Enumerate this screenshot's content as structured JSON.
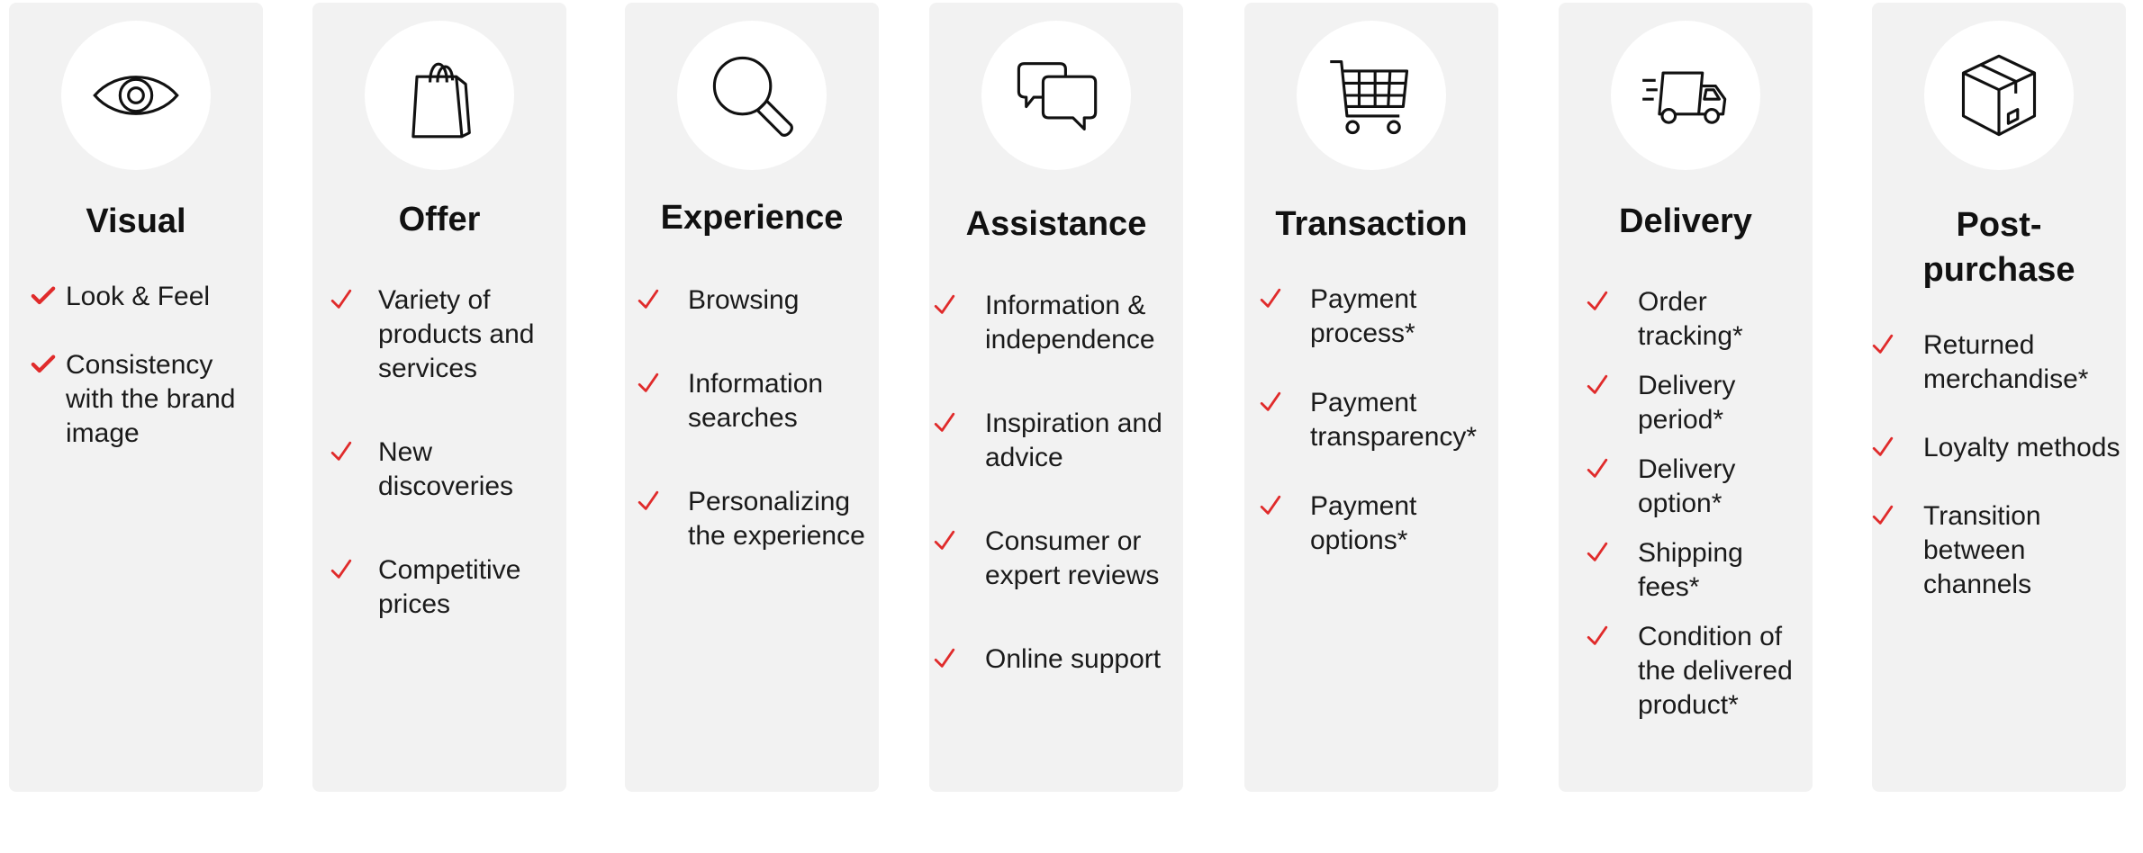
{
  "accent_color": "#e02b2b",
  "columns": [
    {
      "icon": "eye-icon",
      "title": "Visual",
      "items": [
        "Look & Feel",
        "Consistency with the brand image"
      ]
    },
    {
      "icon": "shopping-bag-icon",
      "title": "Offer",
      "items": [
        "Variety of products and services",
        "New discoveries",
        "Competitive prices"
      ]
    },
    {
      "icon": "magnifier-icon",
      "title": "Experience",
      "items": [
        "Browsing",
        "Information searches",
        "Personalizing the experience"
      ]
    },
    {
      "icon": "chat-bubbles-icon",
      "title": "Assistance",
      "items": [
        "Information & independence",
        "Inspiration and advice",
        "Consumer or expert reviews",
        "Online support"
      ]
    },
    {
      "icon": "shopping-cart-icon",
      "title": "Transaction",
      "items": [
        "Payment process*",
        "Payment transparency*",
        "Payment options*"
      ]
    },
    {
      "icon": "delivery-truck-icon",
      "title": "Delivery",
      "items": [
        "Order tracking*",
        "Delivery period*",
        "Delivery option*",
        "Shipping fees*",
        "Condition of the delivered product*"
      ]
    },
    {
      "icon": "package-box-icon",
      "title": "Post-purchase",
      "items": [
        "Returned merchandise*",
        "Loyalty methods",
        "Transition between channels"
      ]
    }
  ]
}
